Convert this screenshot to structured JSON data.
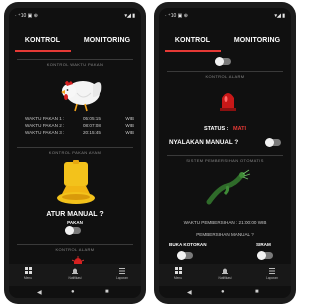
{
  "status_bar": {
    "left": "· ⁺10 ▣ ⊕",
    "right": "▾◢ ▮"
  },
  "tabs": {
    "kontrol": "KONTROL",
    "monitoring": "MONITORING"
  },
  "left_screen": {
    "section_waktu": "KONTROL WAKTU PAKAN",
    "feed_times": [
      {
        "label": "WAKTU PAKAN 1 :",
        "value": "05:05:15",
        "unit": "WIB"
      },
      {
        "label": "WAKTU PAKAN 2 :",
        "value": "08:07:08",
        "unit": "WIB"
      },
      {
        "label": "WAKTU PAKAN 3 :",
        "value": "20:15:45",
        "unit": "WIB"
      }
    ],
    "section_pakan": "KONTROL PAKAN AYAM",
    "atur_manual": "ATUR MANUAL ?",
    "pakan_label": "PAKAN",
    "section_alarm": "KONTROL ALARM"
  },
  "right_screen": {
    "section_alarm": "KONTROL ALARM",
    "status_label": "STATUS :",
    "status_value": "MATI",
    "nyalakan_manual": "NYALAKAN MANUAL ?",
    "section_pembersihan": "SISTEM PEMBERSIHAN OTOMATIS",
    "waktu_pembersihan": "WAKTU PEMBERSIHAN :   21:00:00   WIB",
    "pembersihan_manual": "PEMBERSIHAN MANUAL ?",
    "buka_kotoran": "BUKA KOTORAN",
    "siram": "SIRAM"
  },
  "bottom_nav": [
    {
      "label": "Menu",
      "icon": "grid-icon"
    },
    {
      "label": "Notifikasi",
      "icon": "bell-icon"
    },
    {
      "label": "Laporan",
      "icon": "list-icon"
    }
  ],
  "colors": {
    "accent": "#e53935",
    "background": "#101010",
    "status_off": "#e53935"
  }
}
